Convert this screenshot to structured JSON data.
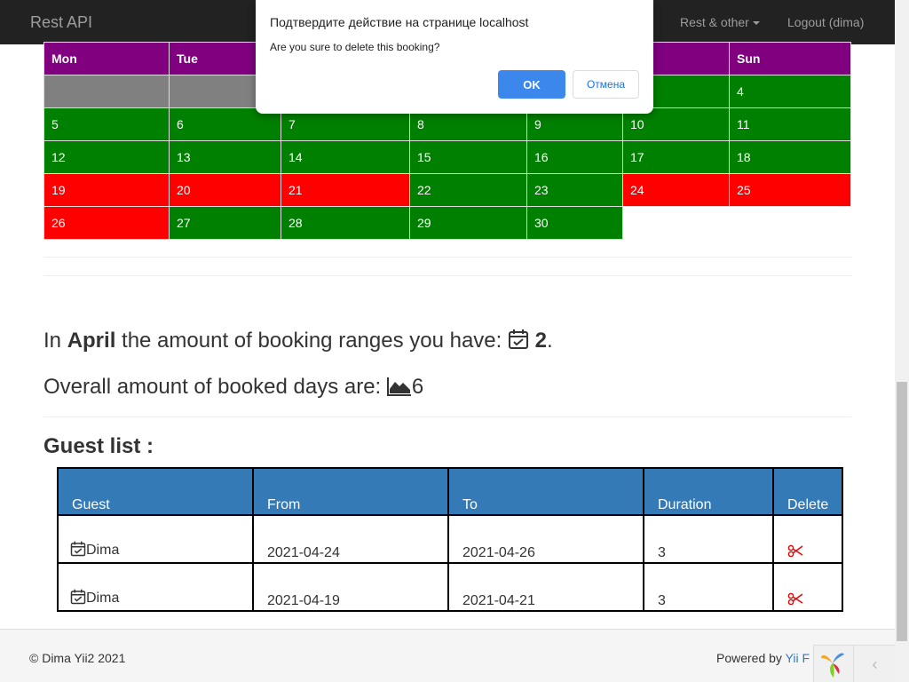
{
  "navbar": {
    "brand": "Rest API",
    "rest_other": "Rest & other",
    "logout": "Logout (dima)"
  },
  "calendar": {
    "headers": [
      "Mon",
      "Tue",
      "",
      "",
      "",
      "",
      "Sun"
    ],
    "rows": [
      [
        {
          "d": "",
          "c": "gray"
        },
        {
          "d": "",
          "c": "gray"
        },
        {
          "d": "",
          "c": "gray"
        },
        {
          "d": "",
          "c": "green"
        },
        {
          "d": "",
          "c": "green"
        },
        {
          "d": "",
          "c": "green"
        },
        {
          "d": "4",
          "c": "green"
        }
      ],
      [
        {
          "d": "5",
          "c": "green"
        },
        {
          "d": "6",
          "c": "green"
        },
        {
          "d": "7",
          "c": "green"
        },
        {
          "d": "8",
          "c": "green"
        },
        {
          "d": "9",
          "c": "green"
        },
        {
          "d": "10",
          "c": "green"
        },
        {
          "d": "11",
          "c": "green"
        }
      ],
      [
        {
          "d": "12",
          "c": "green"
        },
        {
          "d": "13",
          "c": "green"
        },
        {
          "d": "14",
          "c": "green"
        },
        {
          "d": "15",
          "c": "green"
        },
        {
          "d": "16",
          "c": "green"
        },
        {
          "d": "17",
          "c": "green"
        },
        {
          "d": "18",
          "c": "green"
        }
      ],
      [
        {
          "d": "19",
          "c": "red"
        },
        {
          "d": "20",
          "c": "red"
        },
        {
          "d": "21",
          "c": "red"
        },
        {
          "d": "22",
          "c": "green"
        },
        {
          "d": "23",
          "c": "green"
        },
        {
          "d": "24",
          "c": "red"
        },
        {
          "d": "25",
          "c": "red"
        }
      ],
      [
        {
          "d": "26",
          "c": "red"
        },
        {
          "d": "27",
          "c": "green"
        },
        {
          "d": "28",
          "c": "green"
        },
        {
          "d": "29",
          "c": "green"
        },
        {
          "d": "30",
          "c": "green"
        },
        {
          "d": "",
          "c": "empty"
        },
        {
          "d": "",
          "c": "empty"
        }
      ]
    ]
  },
  "stats": {
    "ranges_prefix": "In ",
    "month": "April",
    "ranges_middle": " the amount of booking ranges you have: ",
    "ranges_count": "2",
    "ranges_suffix": ".",
    "days_label": "Overall amount of booked days are: ",
    "days_count": "6"
  },
  "guests": {
    "title": "Guest list :",
    "columns": [
      "Guest",
      "From",
      "To",
      "Duration",
      "Delete"
    ],
    "rows": [
      {
        "guest": "Dima",
        "from": "2021-04-24",
        "to": "2021-04-26",
        "duration": "3"
      },
      {
        "guest": "Dima",
        "from": "2021-04-19",
        "to": "2021-04-21",
        "duration": "3"
      }
    ]
  },
  "footer": {
    "copyright": "© Dima Yii2 2021",
    "powered_prefix": "Powered by ",
    "powered_link": "Yii F"
  },
  "dialog": {
    "title": "Подтвердите действие на странице localhost",
    "message": "Are you sure to delete this booking?",
    "ok": "OK",
    "cancel": "Отмена"
  },
  "colors": {
    "header_purple": "#800080",
    "booked_red": "#ff0000",
    "free_green": "#008000",
    "past_gray": "#808080",
    "table_header_blue": "#337ab7",
    "dialog_blue": "#1a73e8"
  }
}
